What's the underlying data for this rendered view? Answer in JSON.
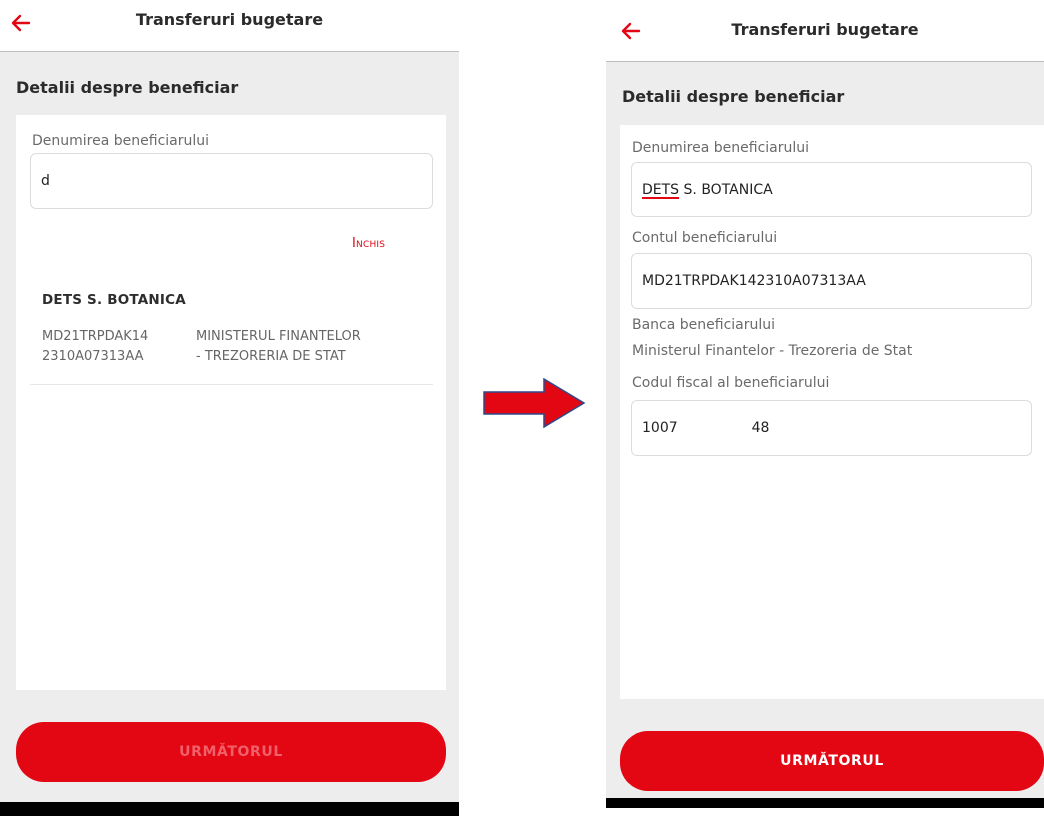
{
  "left": {
    "title": "Transferuri bugetare",
    "section": "Detalii despre beneficiar",
    "name_label": "Denumirea beneficiarului",
    "name_value": "d",
    "close_label": "Inchis",
    "suggestion": {
      "name": "DETS S. BOTANICA",
      "account_line1": "MD21TRPDAK14",
      "account_line2": "2310A07313AA",
      "bank_line1": "MINISTERUL FINANTELOR",
      "bank_line2": "- TREZORERIA DE STAT"
    },
    "next_label": "URMĂTORUL",
    "next_enabled": false
  },
  "right": {
    "title": "Transferuri bugetare",
    "section": "Detalii despre beneficiar",
    "name_label": "Denumirea beneficiarului",
    "name_value_part1": "DETS",
    "name_value_part2": " S. BOTANICA",
    "account_label": "Contul beneficiarului",
    "account_value": "MD21TRPDAK142310A07313AA",
    "bank_label": "Banca beneficiarului",
    "bank_value": "Ministerul Finantelor - Trezoreria de Stat",
    "fiscal_label": "Codul fiscal al beneficiarului",
    "fiscal_part1": "1007",
    "fiscal_part2": "48",
    "next_label": "URMĂTORUL",
    "next_enabled": true
  },
  "colors": {
    "accent": "#e30613",
    "background": "#ededed",
    "card": "#ffffff"
  },
  "icons": {
    "back": "arrow-left-icon",
    "transition": "arrow-right-icon"
  }
}
